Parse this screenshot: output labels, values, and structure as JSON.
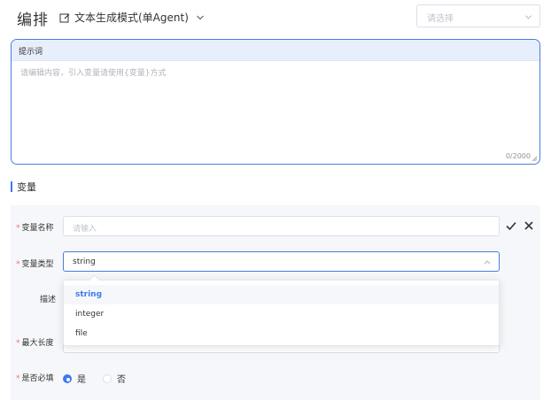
{
  "header": {
    "title": "编排",
    "mode_label": "文本生成模式(单Agent)",
    "top_select_placeholder": "请选择"
  },
  "prompt": {
    "label": "提示词",
    "placeholder": "请编辑内容，引入变量请使用{变量}方式",
    "counter": "0/2000"
  },
  "section": {
    "title": "变量"
  },
  "form": {
    "name_label": "变量名称",
    "name_placeholder": "请输入",
    "type_label": "变量类型",
    "type_value": "string",
    "desc_label": "描述",
    "maxlen_label": "最大长度",
    "required_label": "是否必填",
    "required_yes": "是",
    "required_no": "否",
    "required_value": "是"
  },
  "dropdown": {
    "options": [
      "string",
      "integer",
      "file"
    ],
    "selected": "string"
  },
  "colors": {
    "accent": "#3c7af0",
    "required_mark": "#f56c6c",
    "panel_bg": "#f5f7fa",
    "prompt_header_bg": "#e8effc"
  },
  "icons": {
    "mode": "edit-box-icon",
    "mode_chevron": "chevron-down-icon",
    "select_chevron": "chevron-down-icon",
    "confirm": "check-icon",
    "cancel": "close-icon",
    "type_chevron": "chevron-up-icon",
    "resize": "resize-handle-icon"
  }
}
